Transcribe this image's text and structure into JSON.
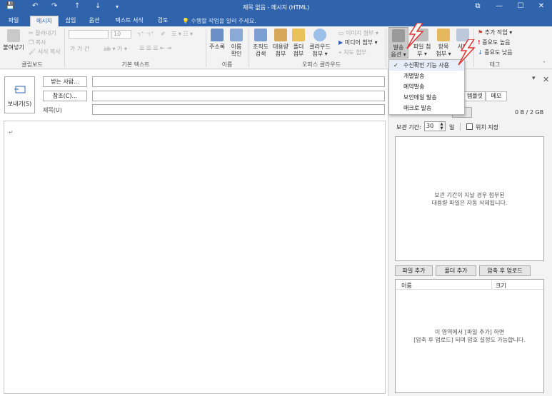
{
  "window": {
    "title": "제목 없음 - 메시지 (HTML)",
    "controls": [
      "⧉",
      "—",
      "☐",
      "✕"
    ]
  },
  "tabs": [
    "파일",
    "메시지",
    "삽입",
    "옵션",
    "텍스트 서식",
    "검토"
  ],
  "active_tab": "메시지",
  "tellme": "수행할 작업을 알려 주세요.",
  "ribbon": {
    "clipboard": {
      "paste": "붙여넣기",
      "cut": "잘라내기",
      "copy": "복사",
      "format_painter": "서식 복사",
      "label": "클립보드"
    },
    "basic_text": {
      "font_size": "10",
      "label": "기본 텍스트"
    },
    "names": {
      "address_book": "주소록",
      "check_names_1": "이름",
      "check_names_2": "확인",
      "label": "이름"
    },
    "office_cloud": {
      "org_search_1": "조직도",
      "org_search_2": "검색",
      "large_attach_1": "대용량",
      "large_attach_2": "첨부",
      "folder_attach_1": "폴더",
      "folder_attach_2": "첨부",
      "cloud_attach_1": "클라우드",
      "cloud_attach_2": "첨부 ▾",
      "image_attach": "이미지 첨부 ▾",
      "media_attach": "미디어 첨부 ▾",
      "map_attach": "지도 첨부",
      "label": "오피스 클라우드"
    },
    "send_options_1": "발송",
    "send_options_2": "옵션 ▾",
    "attach_file_1": "파일 첨",
    "attach_file_2": "부 ▾",
    "attach_item_1": "항목",
    "attach_item_2": "첨부 ▾",
    "signature_1": "서명",
    "tags": {
      "follow_up": "추가 작업 ▾",
      "high": "중요도 높음",
      "low": "중요도 낮음",
      "label": "태그"
    }
  },
  "compose": {
    "send_label": "보내기(S)",
    "to_button": "받는 사람...",
    "cc_button": "참조(C)...",
    "subject_label": "제목(U)",
    "body_mark": "↵"
  },
  "dropdown": {
    "items": [
      "수신확인 기능 사용",
      "개별발송",
      "예약발송",
      "보안메일 발송",
      "매크로 발송"
    ],
    "checked_index": 0
  },
  "pane": {
    "tabs": [
      "템플릿",
      "메모"
    ],
    "usage": "0 B / 2 GB",
    "add_btn": "가",
    "retention_label": "보관 기간:",
    "retention_value": "30",
    "day_unit": "일",
    "position_label": "위치 지정",
    "big_msg_1": "보관 기간이 지날 경우 첨부된",
    "big_msg_2": "대용량 파일은 자동 삭제됩니다.",
    "add_file": "파일 추가",
    "add_folder": "폴더 추가",
    "zip_upload": "압축 후 업로드",
    "col_name": "이름",
    "col_size": "크기",
    "file_msg_1": "이 영역에서 [파일 추가] 하면",
    "file_msg_2": "[압축 후 업로드] 되며 암호 설정도 가능합니다."
  },
  "colors": {
    "accent": "#2f64ad",
    "bolt": "#e03030"
  }
}
